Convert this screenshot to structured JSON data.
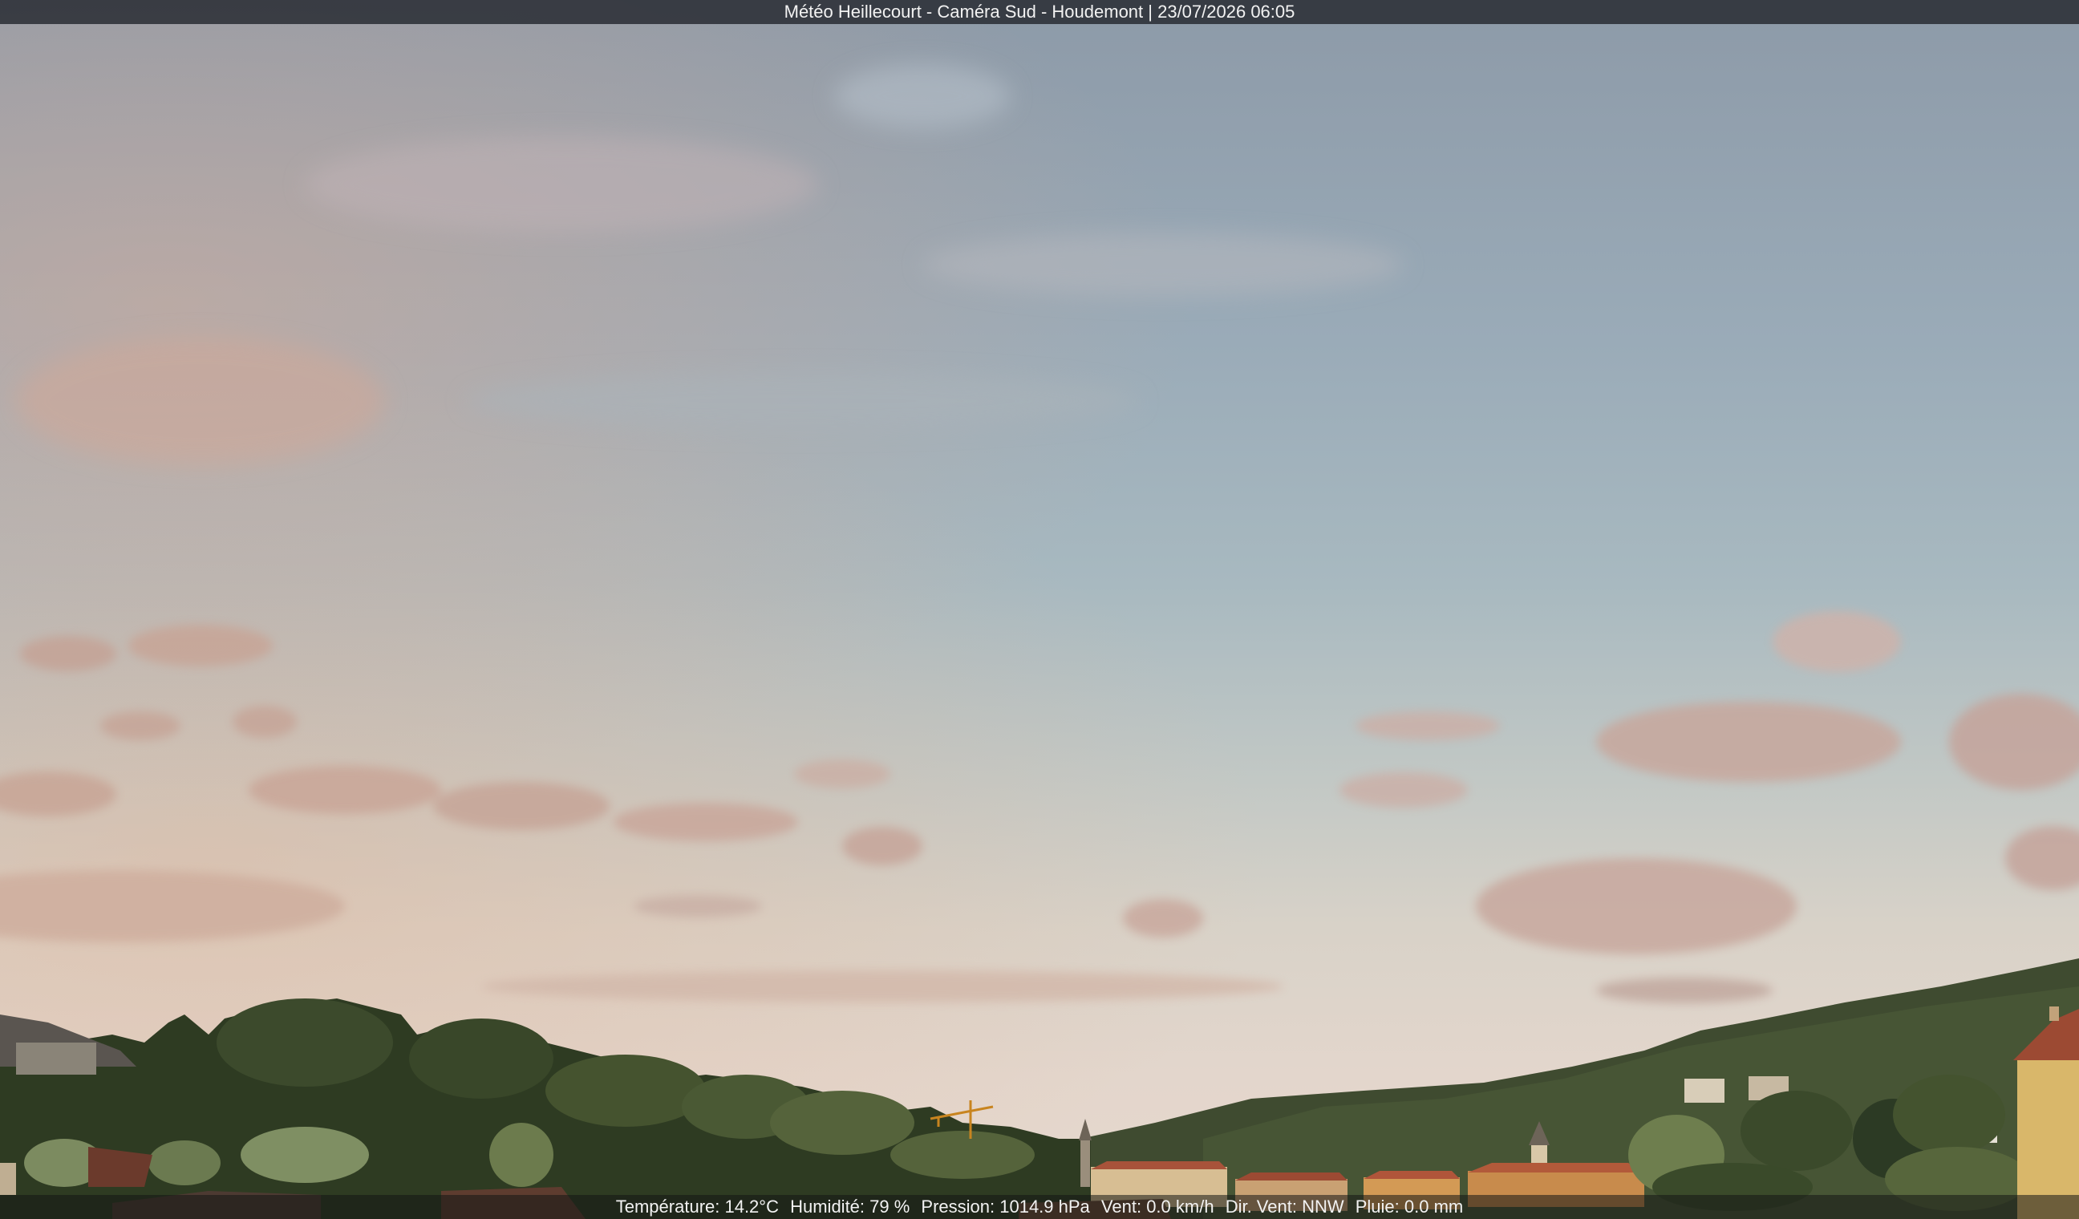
{
  "header": {
    "title": "Météo Heillecourt - Caméra Sud - Houdemont | 23/07/2026 06:05"
  },
  "footer": {
    "temperature": "Température: 14.2°C",
    "humidity": "Humidité: 79 %",
    "pressure": "Pression: 1014.9 hPa",
    "wind_speed": "Vent: 0.0 km/h",
    "wind_dir": "Dir. Vent: NNW",
    "rain": "Pluie: 0.0 mm"
  },
  "colors": {
    "sky_top": "#8d9aa8",
    "sky_horizon": "#e6d8cc",
    "cloud_pink": "#c9a79c",
    "tree_dark": "#2d3a24",
    "tree_mid": "#4a5a36",
    "roof_red": "#b05a3c",
    "wall_yellow": "#d9b76a"
  }
}
